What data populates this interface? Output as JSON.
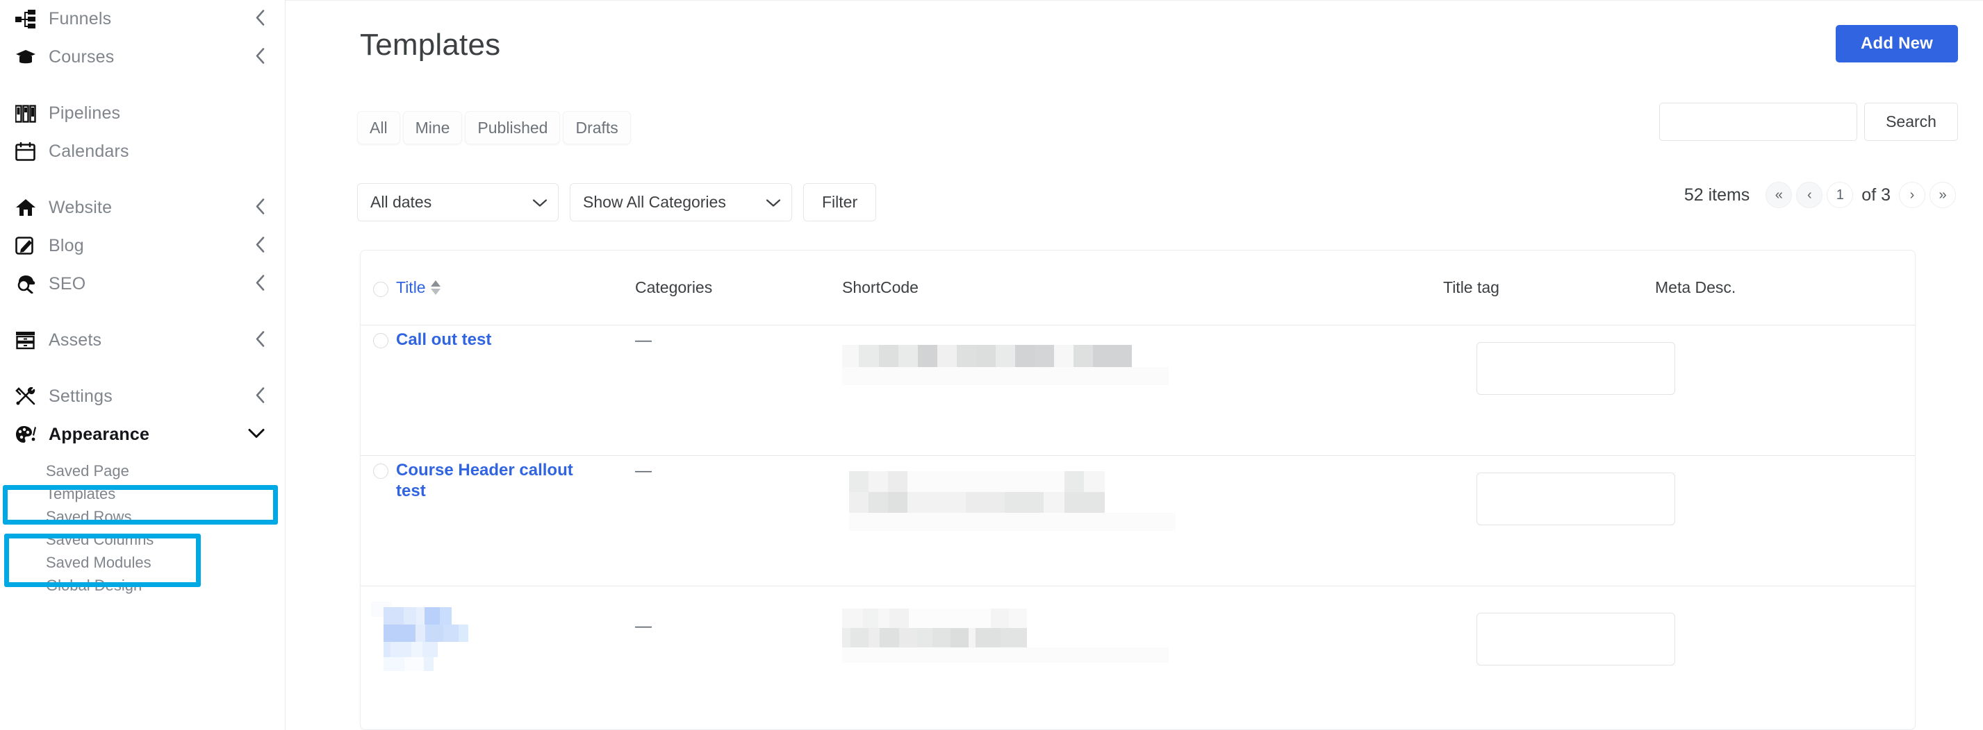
{
  "colors": {
    "accent_blue": "#3064e0",
    "link_blue": "#3064e0",
    "highlight_cyan": "#00a9e3",
    "sidebar_text": "#80858c",
    "heading_text": "#3c4043"
  },
  "sidebar": {
    "groups": [
      {
        "items": [
          {
            "label": "Funnels",
            "icon": "funnels-icon",
            "chevron": "‹"
          },
          {
            "label": "Courses",
            "icon": "courses-icon",
            "chevron": "‹"
          }
        ]
      },
      {
        "items": [
          {
            "label": "Pipelines",
            "icon": "pipelines-icon",
            "chevron": ""
          },
          {
            "label": "Calendars",
            "icon": "calendars-icon",
            "chevron": ""
          }
        ]
      },
      {
        "items": [
          {
            "label": "Website",
            "icon": "website-icon",
            "chevron": "‹"
          },
          {
            "label": "Blog",
            "icon": "blog-icon",
            "chevron": "‹"
          },
          {
            "label": "SEO",
            "icon": "seo-icon",
            "chevron": "‹"
          }
        ]
      },
      {
        "items": [
          {
            "label": "Assets",
            "icon": "assets-icon",
            "chevron": "‹"
          }
        ]
      },
      {
        "items": [
          {
            "label": "Settings",
            "icon": "settings-icon",
            "chevron": "‹"
          }
        ]
      }
    ],
    "appearance": {
      "label": "Appearance",
      "icon": "appearance-icon",
      "chevron": "⌄",
      "highlighted": true
    },
    "sub_items": [
      {
        "label": "Saved Page Templates",
        "highlighted": true
      },
      {
        "label": "Saved Rows",
        "highlighted": false
      },
      {
        "label": "Saved Columns",
        "highlighted": false
      },
      {
        "label": "Saved Modules",
        "highlighted": false
      },
      {
        "label": "Global Design",
        "highlighted": false
      }
    ]
  },
  "header": {
    "title": "Templates",
    "add_new_label": "Add New"
  },
  "tabs": [
    {
      "label": "All"
    },
    {
      "label": "Mine"
    },
    {
      "label": "Published"
    },
    {
      "label": "Drafts"
    }
  ],
  "search": {
    "value": "",
    "placeholder": "",
    "button_label": "Search"
  },
  "filters": {
    "date_select": "All dates",
    "category_select": "Show All Categories",
    "filter_button": "Filter",
    "caret": "⌄"
  },
  "pagination": {
    "items_count": "52 items",
    "first": "«",
    "prev": "‹",
    "current_page": "1",
    "of_label": "of 3",
    "next": "›",
    "last": "»"
  },
  "table": {
    "columns": [
      {
        "key": "title",
        "label": "Title",
        "sortable": true
      },
      {
        "key": "categories",
        "label": "Categories",
        "sortable": false
      },
      {
        "key": "shortcode",
        "label": "ShortCode",
        "sortable": false
      },
      {
        "key": "title_tag",
        "label": "Title tag",
        "sortable": false
      },
      {
        "key": "meta_desc",
        "label": "Meta Desc.",
        "sortable": false
      }
    ],
    "rows": [
      {
        "title": "Call out test",
        "title_redacted": false,
        "categories": "—",
        "shortcode_redacted": true,
        "title_tag_value": "",
        "meta_desc": ""
      },
      {
        "title": "Course Header callout test",
        "title_redacted": false,
        "categories": "—",
        "shortcode_redacted": true,
        "title_tag_value": "",
        "meta_desc": ""
      },
      {
        "title": "",
        "title_redacted": true,
        "categories": "—",
        "shortcode_redacted": true,
        "title_tag_value": "",
        "meta_desc": ""
      }
    ]
  }
}
